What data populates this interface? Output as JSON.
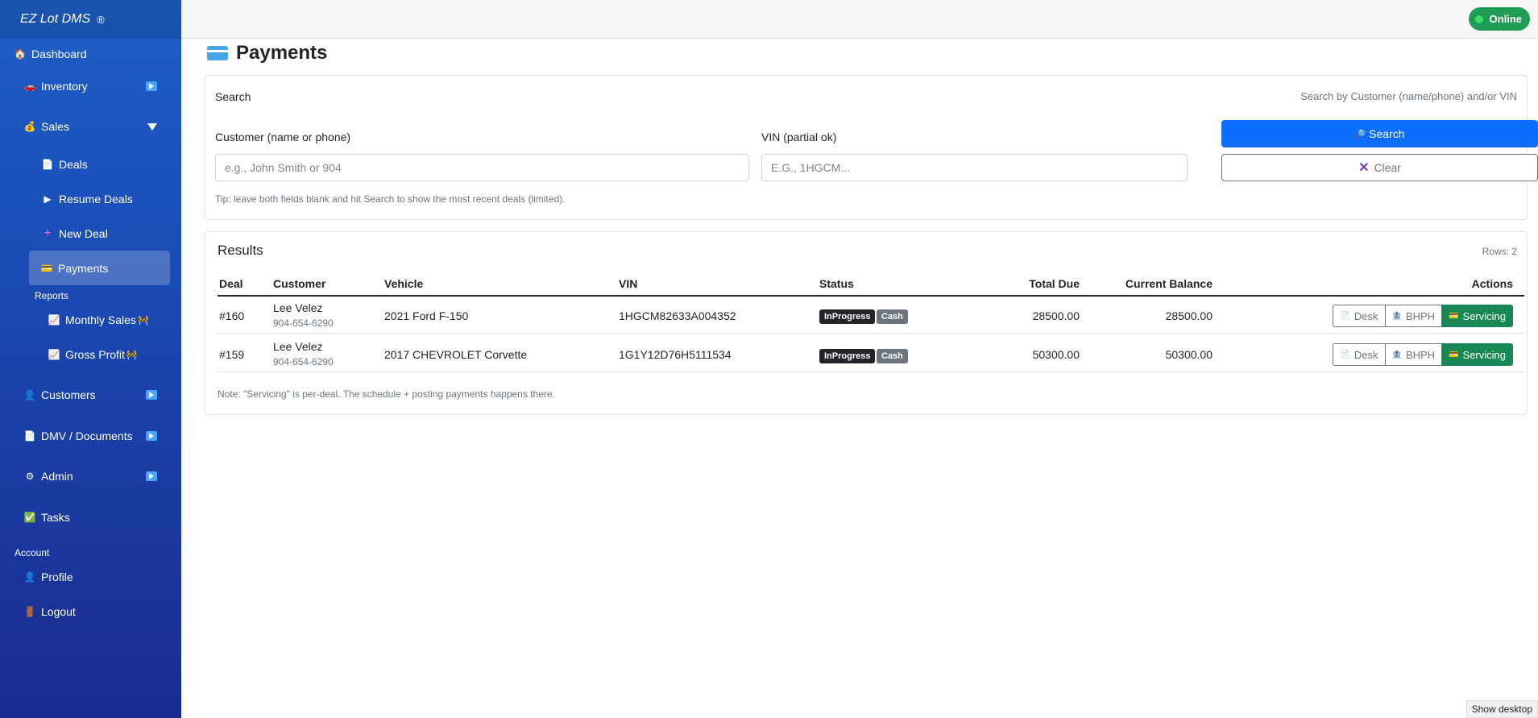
{
  "brand": {
    "name": "EZ Lot DMS",
    "mark": "®"
  },
  "sidebar": {
    "items": [
      {
        "key": "dashboard",
        "label": "Dashboard",
        "icon": "🏠"
      },
      {
        "key": "inventory",
        "label": "Inventory",
        "icon": "🚗"
      },
      {
        "key": "sales",
        "label": "Sales",
        "icon": "💰"
      },
      {
        "key": "deals",
        "label": "Deals",
        "icon": "📄"
      },
      {
        "key": "resume-deals",
        "label": "Resume Deals",
        "icon": "▶"
      },
      {
        "key": "new-deal",
        "label": "New Deal",
        "icon": "+"
      },
      {
        "key": "payments",
        "label": "Payments",
        "icon": "💳"
      },
      {
        "key": "monthly-sales",
        "label": "Monthly Sales",
        "icon": "📈",
        "badge": "🚧"
      },
      {
        "key": "gross-profit",
        "label": "Gross Profit",
        "icon": "📈",
        "badge": "🚧"
      },
      {
        "key": "customers",
        "label": "Customers",
        "icon": "👤"
      },
      {
        "key": "dmv",
        "label": "DMV / Documents",
        "icon": "📄"
      },
      {
        "key": "admin",
        "label": "Admin",
        "icon": "⚙"
      },
      {
        "key": "tasks",
        "label": "Tasks",
        "icon": "✅"
      },
      {
        "key": "profile",
        "label": "Profile",
        "icon": "👤"
      },
      {
        "key": "logout",
        "label": "Logout",
        "icon": "🚪"
      }
    ],
    "sections": {
      "reports": "Reports",
      "account": "Account"
    }
  },
  "topbar": {
    "status": "Online"
  },
  "page": {
    "title": "Payments"
  },
  "search": {
    "title": "Search",
    "hint": "Search by Customer (name/phone) and/or VIN",
    "customer_label": "Customer (name or phone)",
    "customer_placeholder": "e.g., John Smith or 904",
    "customer_value": "",
    "vin_label": "VIN (partial ok)",
    "vin_placeholder": "E.G., 1HGCM...",
    "vin_value": "",
    "search_button": "Search",
    "clear_button": "Clear",
    "tip": "Tip: leave both fields blank and hit Search to show the most recent deals (limited)."
  },
  "results": {
    "title": "Results",
    "rows_label": "Rows: 2",
    "columns": [
      "Deal",
      "Customer",
      "Vehicle",
      "VIN",
      "Status",
      "Total Due",
      "Current Balance",
      "Actions"
    ],
    "rows": [
      {
        "deal": "#160",
        "customer": "Lee Velez",
        "phone": "904-654-6290",
        "vehicle": "2021 Ford F-150",
        "vin": "1HGCM82633A004352",
        "status": "InProgress",
        "type": "Cash",
        "total_due": "28500.00",
        "balance": "28500.00"
      },
      {
        "deal": "#159",
        "customer": "Lee Velez",
        "phone": "904-654-6290",
        "vehicle": "2017 CHEVROLET Corvette",
        "vin": "1G1Y12D76H5111534",
        "status": "InProgress",
        "type": "Cash",
        "total_due": "50300.00",
        "balance": "50300.00"
      }
    ],
    "actions": {
      "desk": "Desk",
      "bhph": "BHPH",
      "servicing": "Servicing"
    },
    "note": "Note: \"Servicing\" is per-deal. The schedule + posting payments happens there."
  },
  "footer": {
    "show_desktop": "Show desktop"
  },
  "colors": {
    "primary": "#0d6efd",
    "success": "#198754",
    "sidebar": "#1a47b0"
  }
}
